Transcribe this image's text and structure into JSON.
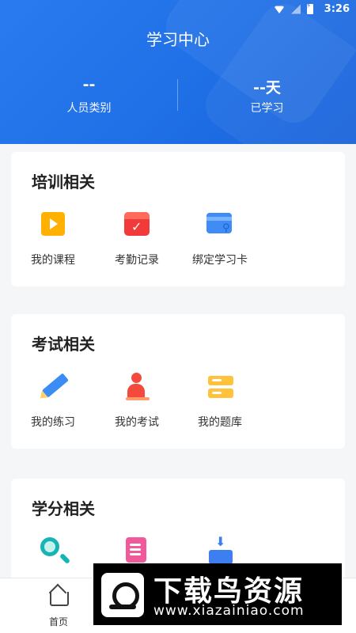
{
  "statusbar": {
    "time": "3:26"
  },
  "header": {
    "title": "学习中心",
    "stats": [
      {
        "value": "--",
        "label": "人员类别"
      },
      {
        "value": "--天",
        "label": "已学习"
      }
    ]
  },
  "sections": [
    {
      "title": "培训相关",
      "items": [
        {
          "label": "我的课程",
          "icon": "video-course-icon"
        },
        {
          "label": "考勤记录",
          "icon": "calendar-check-icon"
        },
        {
          "label": "绑定学习卡",
          "icon": "card-link-icon"
        }
      ]
    },
    {
      "title": "考试相关",
      "items": [
        {
          "label": "我的练习",
          "icon": "pencil-icon"
        },
        {
          "label": "我的考试",
          "icon": "exam-person-icon"
        },
        {
          "label": "我的题库",
          "icon": "question-bank-icon"
        }
      ]
    },
    {
      "title": "学分相关",
      "items": [
        {
          "icon": "search-icon"
        },
        {
          "icon": "document-edit-icon"
        },
        {
          "icon": "download-icon"
        }
      ]
    }
  ],
  "tabbar": {
    "home_label": "首页"
  },
  "watermark": {
    "brand": "下载鸟资源",
    "url": "www.xiazainiao.com"
  },
  "colors": {
    "primary": "#1f6fe6",
    "background": "#f5f6f8"
  }
}
